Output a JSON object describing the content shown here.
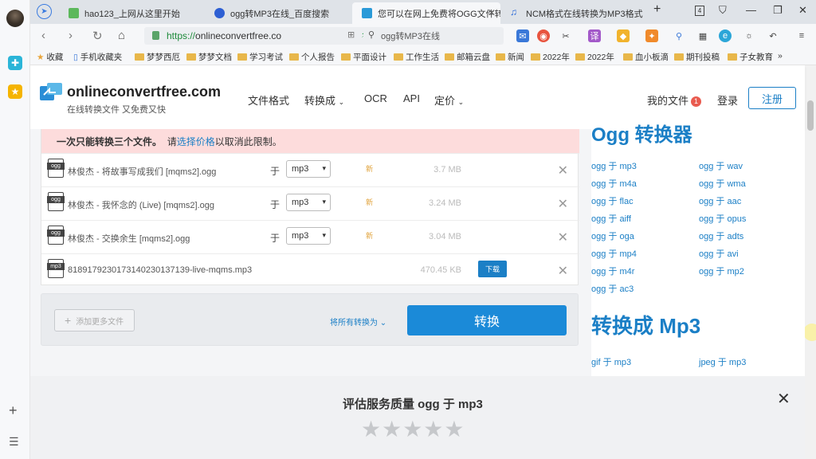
{
  "tabs": [
    {
      "label": "hao123_上网从这里开始",
      "active": false
    },
    {
      "label": "ogg转MP3在线_百度搜索",
      "active": false
    },
    {
      "label": "您可以在网上免费将OGG文件转",
      "active": true
    },
    {
      "label": "NCM格式在线转换为MP3格式",
      "active": false
    }
  ],
  "tab_count": "4",
  "address": {
    "scheme": "https://",
    "host": "onlineconvertfree.co",
    "search": "ogg转MP3在线"
  },
  "bookmarks": [
    "收藏",
    "手机收藏夹",
    "梦梦西厄",
    "梦梦文档",
    "学习考试",
    "个人报告",
    "平面设计",
    "工作生活",
    "邮箱云盘",
    "新闻",
    "2022年",
    "2022年",
    "血小板滴",
    "期刊投稿",
    "子女教育",
    "»"
  ],
  "site": {
    "logo": "onlineconvertfree.com",
    "tagline": "在线转换文件 又免费又快",
    "nav": [
      "文件格式",
      "转换成",
      "OCR",
      "API",
      "定价"
    ],
    "my_files": "我的文件",
    "files_badge": "1",
    "login": "登录",
    "signup": "注册"
  },
  "warning": {
    "bold": "一次只能转换三个文件。",
    "pre": "请",
    "link": "选择价格",
    "post": "以取消此限制。"
  },
  "files": [
    {
      "icon": "ogg",
      "name": "林俊杰 - 将故事写成我们 [mqms2].ogg",
      "to": "于",
      "format": "mp3",
      "status": "新",
      "size": "3.7 MB"
    },
    {
      "icon": "ogg",
      "name": "林俊杰 - 我怀念的 (Live) [mqms2].ogg",
      "to": "于",
      "format": "mp3",
      "status": "新",
      "size": "3.24 MB"
    },
    {
      "icon": "ogg",
      "name": "林俊杰 - 交换余生 [mqms2].ogg",
      "to": "于",
      "format": "mp3",
      "status": "新",
      "size": "3.04 MB"
    },
    {
      "icon": "mp3",
      "name": "818917923017314023013713​9-live-mqms.mp3",
      "size": "470.45 KB",
      "download": "下载"
    }
  ],
  "actions": {
    "add": "添加更多文件",
    "convert_all": "将所有转换为",
    "convert": "转换"
  },
  "sidebar": {
    "title1": "Ogg 转换器",
    "links1": [
      "ogg 于 mp3",
      "ogg 于 wav",
      "ogg 于 m4a",
      "ogg 于 wma",
      "ogg 于 flac",
      "ogg 于 aac",
      "ogg 于 aiff",
      "ogg 于 opus",
      "ogg 于 oga",
      "ogg 于 adts",
      "ogg 于 mp4",
      "ogg 于 avi",
      "ogg 于 m4r",
      "ogg 于 mp2",
      "ogg 于 ac3"
    ],
    "title2": "转换成 Mp3",
    "links2": [
      "gif 于 mp3",
      "jpeg 于 mp3"
    ]
  },
  "survey": {
    "question": "评估服务质量 ogg 于 mp3",
    "stars": "★★★★★",
    "close": "✕"
  }
}
